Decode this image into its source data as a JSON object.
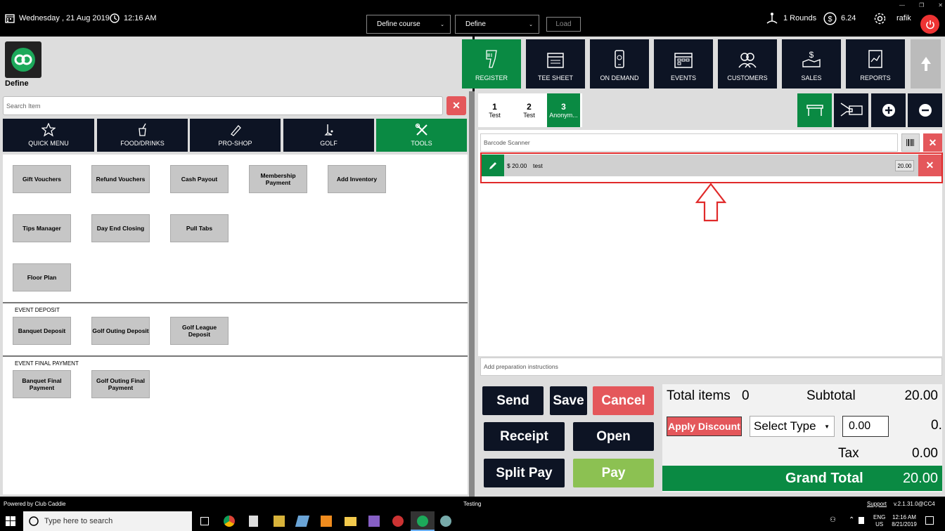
{
  "header": {
    "date": "Wednesday ,  21 Aug 2019",
    "time": "12:16 AM",
    "course_select": "Define course",
    "define_select": "Define",
    "load_label": "Load",
    "rounds": "1 Rounds",
    "balance": "6.24",
    "user": "rafik"
  },
  "company_name": "Define",
  "nav": [
    {
      "label": "REGISTER",
      "icon": "barcode-scanner-icon"
    },
    {
      "label": "TEE SHEET",
      "icon": "calendar-icon"
    },
    {
      "label": "ON DEMAND",
      "icon": "phone-icon"
    },
    {
      "label": "EVENTS",
      "icon": "events-calendar-icon"
    },
    {
      "label": "CUSTOMERS",
      "icon": "customers-icon"
    },
    {
      "label": "SALES",
      "icon": "sales-icon"
    },
    {
      "label": "REPORTS",
      "icon": "reports-icon"
    }
  ],
  "search_placeholder": "Search Item",
  "categories": [
    {
      "label": "QUICK MENU",
      "icon": "star-icon"
    },
    {
      "label": "FOOD/DRINKS",
      "icon": "food-icon"
    },
    {
      "label": "PRO-SHOP",
      "icon": "pro-shop-icon"
    },
    {
      "label": "GOLF",
      "icon": "golf-icon"
    },
    {
      "label": "TOOLS",
      "icon": "tools-icon"
    }
  ],
  "tools": {
    "row1": [
      "Gift Vouchers",
      "Refund Vouchers",
      "Cash Payout",
      "Membership Payment",
      "Add Inventory"
    ],
    "row2": [
      "Tips Manager",
      "Day End Closing",
      "Pull Tabs"
    ],
    "row3": [
      "Floor Plan"
    ],
    "event_deposit_title": "EVENT DEPOSIT",
    "event_deposit": [
      "Banquet Deposit",
      "Golf Outing Deposit",
      "Golf League Deposit"
    ],
    "event_final_title": "EVENT FINAL PAYMENT",
    "event_final": [
      "Banquet Final Payment",
      "Golf Outing Final Payment"
    ]
  },
  "tabs": [
    {
      "num": "1",
      "name": "Test"
    },
    {
      "num": "2",
      "name": "Test"
    },
    {
      "num": "3",
      "name": "Anonym..."
    }
  ],
  "barcode_placeholder": "Barcode Scanner",
  "order_item": {
    "price": "$  20.00",
    "name": "test",
    "qty": "20.00"
  },
  "prep_placeholder": "Add preparation instructions",
  "actions": {
    "send": "Send",
    "save": "Save",
    "cancel": "Cancel",
    "receipt": "Receipt",
    "open": "Open",
    "split": "Split Pay",
    "pay": "Pay"
  },
  "totals": {
    "items_label": "Total items",
    "items": "0",
    "subtotal_label": "Subtotal",
    "subtotal": "20.00",
    "apply_discount": "Apply Discount",
    "select_type": "Select Type",
    "discount_value": "0.00",
    "discount_amount": "0.",
    "tax_label": "Tax",
    "tax": "0.00",
    "grand_label": "Grand Total",
    "grand": "20.00"
  },
  "status_bar": {
    "powered": "Powered by Club Caddie",
    "env": "Testing",
    "support": "Support",
    "version": "v.2.1.31.0@CC4"
  },
  "taskbar": {
    "search": "Type here to search",
    "lang1": "ENG",
    "lang2": "US",
    "time": "12:16 AM",
    "date": "8/21/2019"
  }
}
